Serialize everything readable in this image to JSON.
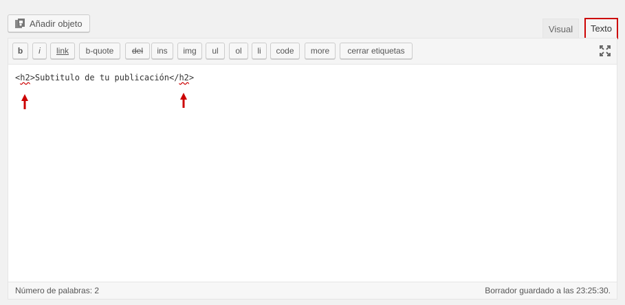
{
  "media": {
    "add_label": "Añadir objeto",
    "icon": "add-media-icon"
  },
  "tabs": {
    "visual": "Visual",
    "texto": "Texto",
    "active": "texto",
    "highlight_color": "#cc0000"
  },
  "toolbar": {
    "buttons": [
      "b",
      "i",
      "link",
      "b-quote",
      "del",
      "ins",
      "img",
      "ul",
      "ol",
      "li",
      "code",
      "more",
      "cerrar etiquetas"
    ],
    "fullscreen_icon": "fullscreen-icon"
  },
  "content": {
    "open_lt": "<",
    "open_tag": "h2",
    "open_gt": ">",
    "text": "Subtitulo de tu publicación",
    "close_lt": "</",
    "close_tag": "h2",
    "close_gt": ">",
    "arrow_color": "#cc0000"
  },
  "status": {
    "word_count": "Número de palabras: 2",
    "draft_saved": "Borrador guardado a las 23:25:30."
  }
}
